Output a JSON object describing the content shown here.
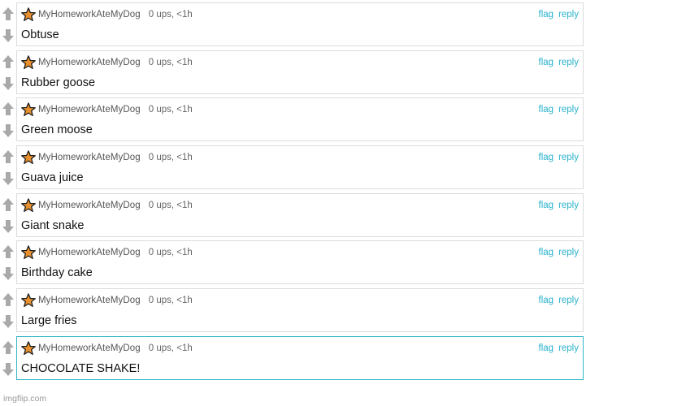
{
  "comments": [
    {
      "user": "MyHomeworkAteMyDog",
      "meta": "0 ups, <1h",
      "flag": "flag",
      "reply": "reply",
      "text": "Obtuse"
    },
    {
      "user": "MyHomeworkAteMyDog",
      "meta": "0 ups, <1h",
      "flag": "flag",
      "reply": "reply",
      "text": "Rubber goose"
    },
    {
      "user": "MyHomeworkAteMyDog",
      "meta": "0 ups, <1h",
      "flag": "flag",
      "reply": "reply",
      "text": "Green moose"
    },
    {
      "user": "MyHomeworkAteMyDog",
      "meta": "0 ups, <1h",
      "flag": "flag",
      "reply": "reply",
      "text": "Guava juice"
    },
    {
      "user": "MyHomeworkAteMyDog",
      "meta": "0 ups, <1h",
      "flag": "flag",
      "reply": "reply",
      "text": "Giant snake"
    },
    {
      "user": "MyHomeworkAteMyDog",
      "meta": "0 ups, <1h",
      "flag": "flag",
      "reply": "reply",
      "text": "Birthday cake"
    },
    {
      "user": "MyHomeworkAteMyDog",
      "meta": "0 ups, <1h",
      "flag": "flag",
      "reply": "reply",
      "text": "Large fries"
    },
    {
      "user": "MyHomeworkAteMyDog",
      "meta": "0 ups, <1h",
      "flag": "flag",
      "reply": "reply",
      "text": "CHOCOLATE SHAKE!"
    }
  ],
  "watermark": "imgflip.com",
  "icons": {
    "upvote": "arrow-up-icon",
    "downvote": "arrow-down-icon",
    "avatar": "star-avatar-icon"
  },
  "colors": {
    "link": "#2ab2cc",
    "highlight_border": "#33b8c9",
    "border": "#dcdcdc",
    "arrow": "#a9a9a9",
    "star_fill": "#e8902e",
    "star_outline": "#1a1a1a"
  }
}
